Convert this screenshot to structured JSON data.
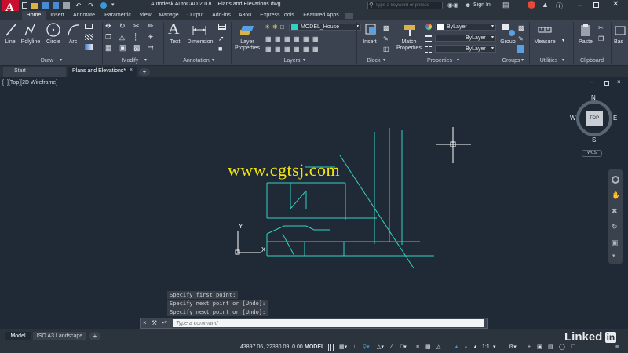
{
  "app": {
    "logo_letter": "A",
    "title": "Autodesk AutoCAD 2018",
    "document": "Plans and Elevations.dwg",
    "search_placeholder": "Type a keyword or phrase",
    "sign_in": "Sign In"
  },
  "ribbon_tabs": [
    "Home",
    "Insert",
    "Annotate",
    "Parametric",
    "View",
    "Manage",
    "Output",
    "Add-ins",
    "A360",
    "Express Tools",
    "Featured Apps"
  ],
  "draw_tools": [
    "Line",
    "Polyline",
    "Circle",
    "Arc"
  ],
  "annotation_tools": [
    "Text",
    "Dimension"
  ],
  "layer_properties": [
    "Layer",
    "Properties"
  ],
  "layer_name": "MODEL_House",
  "insert_label": "Insert",
  "match_properties": [
    "Match",
    "Properties"
  ],
  "bylayer": [
    "ByLayer",
    "ByLayer",
    "ByLayer"
  ],
  "group_label": "Group",
  "measure_label": "Measure",
  "paste_label": "Paste",
  "base_label": "Bas",
  "panels": [
    "Draw",
    "Modify",
    "Annotation",
    "Layers",
    "Block",
    "Properties",
    "Groups",
    "Utilities",
    "Clipboard"
  ],
  "file_tabs": [
    "Start",
    "Plans and Elevations*"
  ],
  "viewport_label": "[−][Top][2D Wireframe]",
  "viewcube": {
    "n": "N",
    "s": "S",
    "e": "E",
    "w": "W",
    "face": "TOP",
    "ucs": "WCS"
  },
  "ucs_icon": {
    "x": "X",
    "y": "Y"
  },
  "watermark": "www.cgtsj.com",
  "command_history": [
    "Specify first point:",
    "Specify next point or [Undo]:",
    "Specify next point or [Undo]:"
  ],
  "command_placeholder": "Type a command",
  "layout_tabs": [
    "Model",
    "ISO A3 Landscape"
  ],
  "status": {
    "coords": "43897.06, 22380.09, 0.00",
    "space": "MODEL",
    "scale": "1:1"
  },
  "brand": {
    "text": "Linked",
    "badge": "in"
  },
  "colors": {
    "accent": "#c8102e",
    "linework": "#2fd3c4",
    "watermark": "#f1e60b",
    "background": "#1f2a36"
  }
}
